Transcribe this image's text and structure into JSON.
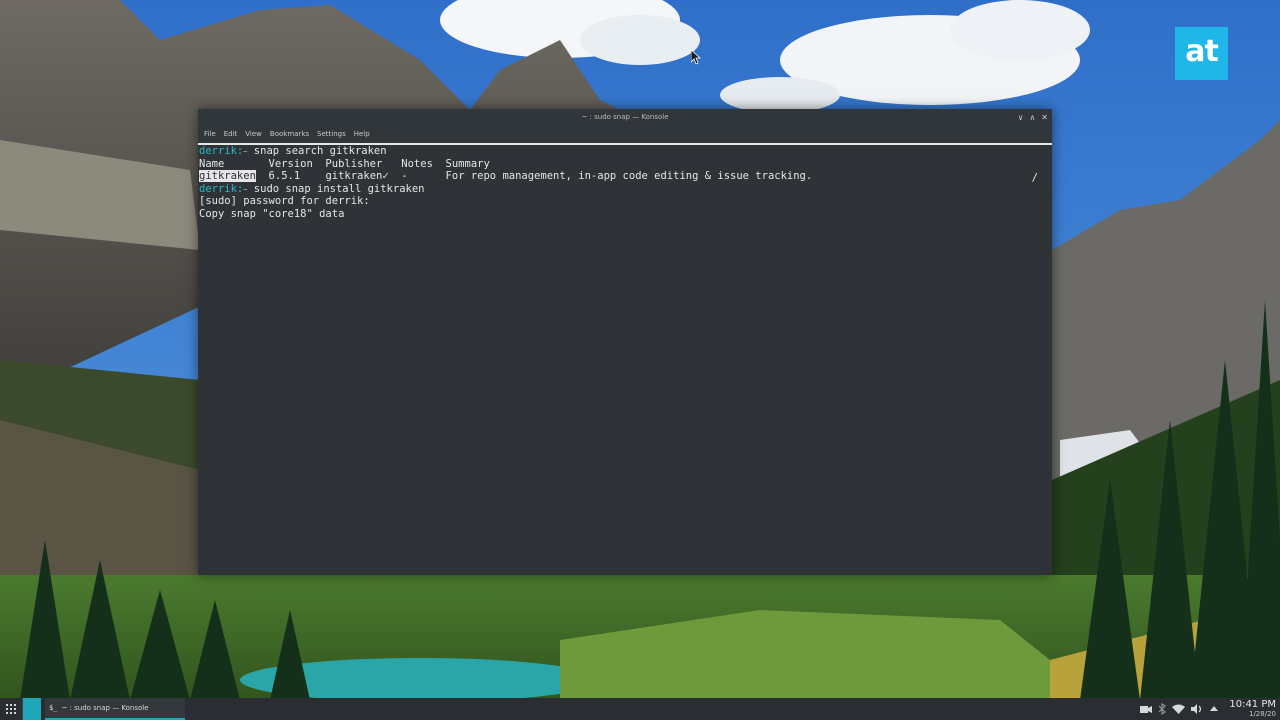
{
  "brand": {
    "logo_text": "at",
    "color": "#1fb6e8"
  },
  "window": {
    "title": "~ : sudo snap — Konsole",
    "controls": {
      "minimize": "∨",
      "maximize": "∧",
      "close": "✕"
    },
    "menu": [
      "File",
      "Edit",
      "View",
      "Bookmarks",
      "Settings",
      "Help"
    ]
  },
  "terminal": {
    "prompt_user": "derrik:",
    "prompt_dir": "~",
    "command1": " snap search gitkraken",
    "header": "Name       Version  Publisher   Notes  Summary",
    "result_name": "gitkraken",
    "result_rest": "  6.5.1    gitkraken✓  -      For repo management, in-app code editing & issue tracking.",
    "command2": " sudo snap install gitkraken",
    "sudo_prompt": "[sudo] password for derrik:",
    "progress": "Copy snap \"core18\" data",
    "spinner": "/",
    "colors": {
      "prompt": "#2ab7c7",
      "background": "#2f3237",
      "text": "#e6e6e6"
    }
  },
  "taskbar": {
    "launcher_icon": "app-grid-icon",
    "task_icon_text": "$_",
    "task_label": "~ : sudo snap — Konsole",
    "tray_icons": [
      "camera-icon",
      "bluetooth-icon",
      "wifi-icon",
      "volume-icon",
      "chevron-up-icon"
    ],
    "time": "10:41 PM",
    "date": "1/28/20",
    "accent": "#1ea7b8"
  }
}
